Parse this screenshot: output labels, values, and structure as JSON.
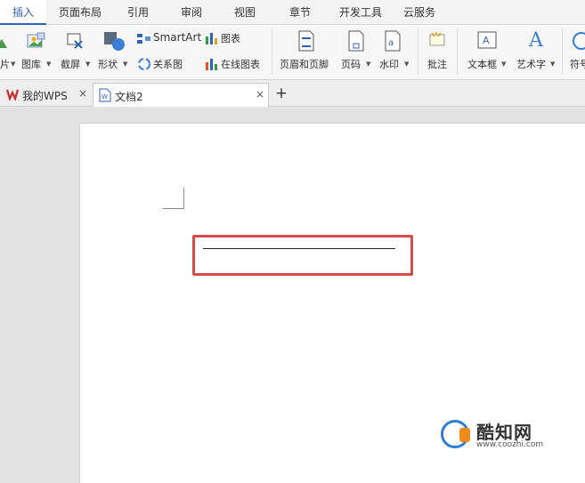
{
  "ribbon_tabs": [
    "插入",
    "页面布局",
    "引用",
    "审阅",
    "视图",
    "章节",
    "开发工具",
    "云服务"
  ],
  "ribbon": {
    "partial_left": "片",
    "picture_lib": "图库",
    "screenshot": "截屏",
    "shapes": "形状",
    "smartart": "SmartArt",
    "chart": "图表",
    "relation_chart": "关系图",
    "online_chart": "在线图表",
    "header_footer": "页眉和页脚",
    "page_number": "页码",
    "watermark": "水印",
    "comment": "批注",
    "textbox": "文本框",
    "wordart": "艺术字",
    "symbol": "符号"
  },
  "doc_tabs": [
    {
      "label": "我的WPS"
    },
    {
      "label": "文档2"
    }
  ],
  "add_tab": "+",
  "close_glyph": "×",
  "watermark": {
    "title": "酷知网",
    "url": "www.coozhi.com"
  },
  "colors": {
    "accent": "#2f63b8",
    "highlight": "#d94a4a",
    "wps_red": "#d0282e"
  }
}
